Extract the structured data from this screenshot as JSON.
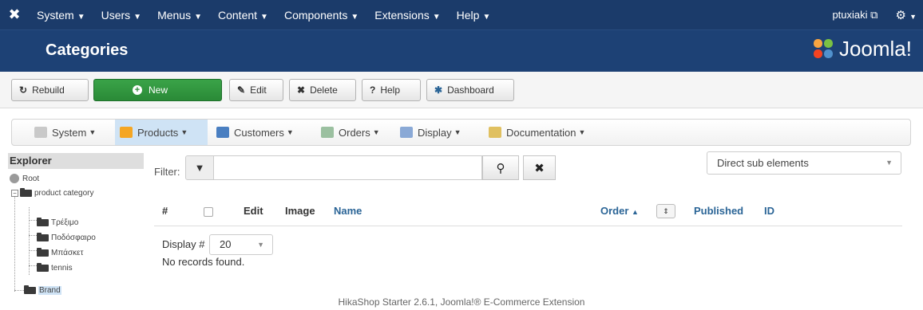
{
  "topnav": {
    "menus": [
      "System",
      "Users",
      "Menus",
      "Content",
      "Components",
      "Extensions",
      "Help"
    ],
    "user": "ptuxiaki"
  },
  "header": {
    "title": "Categories",
    "brand": "Joomla!"
  },
  "toolbar": {
    "rebuild": "Rebuild",
    "new": "New",
    "edit": "Edit",
    "delete": "Delete",
    "help": "Help",
    "dashboard": "Dashboard"
  },
  "hikanav": {
    "items": [
      "System",
      "Products",
      "Customers",
      "Orders",
      "Display",
      "Documentation"
    ],
    "active": "Products"
  },
  "explorer": {
    "title": "Explorer",
    "root": "Root",
    "category": "product category",
    "children": [
      "Τρέξιμο",
      "Ποδόσφαιρο",
      "Μπάσκετ",
      "tennis"
    ],
    "brand": "Brand"
  },
  "filter": {
    "label": "Filter:",
    "value": ""
  },
  "view_select": "Direct sub elements",
  "table": {
    "headers": {
      "num": "#",
      "edit": "Edit",
      "image": "Image",
      "name": "Name",
      "order": "Order",
      "published": "Published",
      "id": "ID"
    }
  },
  "display": {
    "label": "Display #",
    "value": "20"
  },
  "empty_text": "No records found.",
  "footer": "HikaShop Starter 2.6.1, Joomla!® E-Commerce Extension"
}
